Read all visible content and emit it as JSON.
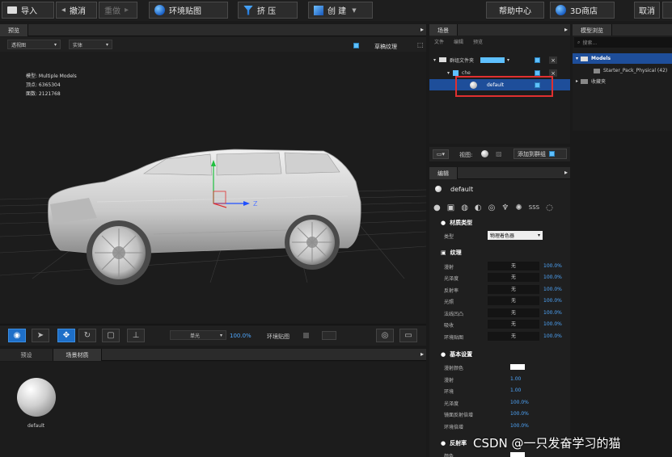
{
  "toolbar": {
    "import": "导入",
    "undo": "撤消",
    "redo": "重做",
    "env_map": "环境贴图",
    "extrude": "挤 压",
    "create": "创 建",
    "help": "帮助中心",
    "store": "3D商店",
    "cancel": "取消"
  },
  "preview": {
    "title": "预览",
    "view_mode": "透视图",
    "shading": "实体",
    "sketch_texture": "草稿纹理",
    "info_model": "模型: Multiple Models",
    "info_verts": "顶点: 6365304",
    "info_faces": "面数: 2121768",
    "light_mode": "单光",
    "light_pct": "100.0%",
    "env_map_label": "环境贴图"
  },
  "presets": {
    "tab_presets": "预设",
    "tab_scene_materials": "场景材质",
    "material_name": "default"
  },
  "scene": {
    "title": "场景",
    "menu": [
      "文件",
      "编辑",
      "预览"
    ],
    "group_folder": "群组文件夹",
    "child": "che",
    "material": "default",
    "view_label": "视图:",
    "add_to_group": "添加到群组"
  },
  "edit": {
    "title": "编辑",
    "material_name": "default",
    "material_type_title": "材质类型",
    "type_label": "类型",
    "type_value": "物理着色器",
    "texture_title": "纹理",
    "texture_rows": [
      {
        "label": "漫射",
        "value": "无",
        "pct": "100.0%"
      },
      {
        "label": "光泽度",
        "value": "无",
        "pct": "100.0%"
      },
      {
        "label": "反射率",
        "value": "无",
        "pct": "100.0%"
      },
      {
        "label": "光照",
        "value": "无",
        "pct": "100.0%"
      },
      {
        "label": "法线凹凸",
        "value": "无",
        "pct": "100.0%"
      },
      {
        "label": "吸收",
        "value": "无",
        "pct": "100.0%"
      },
      {
        "label": "环境贴图",
        "value": "无",
        "pct": "100.0%"
      }
    ],
    "basic_title": "基本设置",
    "basic_rows": [
      {
        "label": "漫射颜色",
        "value": ""
      },
      {
        "label": "漫射",
        "value": "1.00"
      },
      {
        "label": "环境",
        "value": "1.00"
      },
      {
        "label": "光泽度",
        "value": "100.0%"
      },
      {
        "label": "镜面反射倍增",
        "value": "100.0%"
      },
      {
        "label": "环境倍增",
        "value": "100.0%"
      }
    ],
    "reflect_title": "反射率",
    "color_label": "颜色"
  },
  "models": {
    "title": "模型浏览",
    "search_placeholder": "搜索...",
    "root": "Models",
    "pack": "Starter_Pack_Physical (42)",
    "favorites": "收藏夹"
  },
  "watermark": "CSDN @一只发奋学习的猫",
  "colors": {
    "accent": "#1e6fc8",
    "selected_row": "#1e4e9a",
    "highlight_box": "#e03030",
    "value_blue": "#4fa8ff"
  }
}
